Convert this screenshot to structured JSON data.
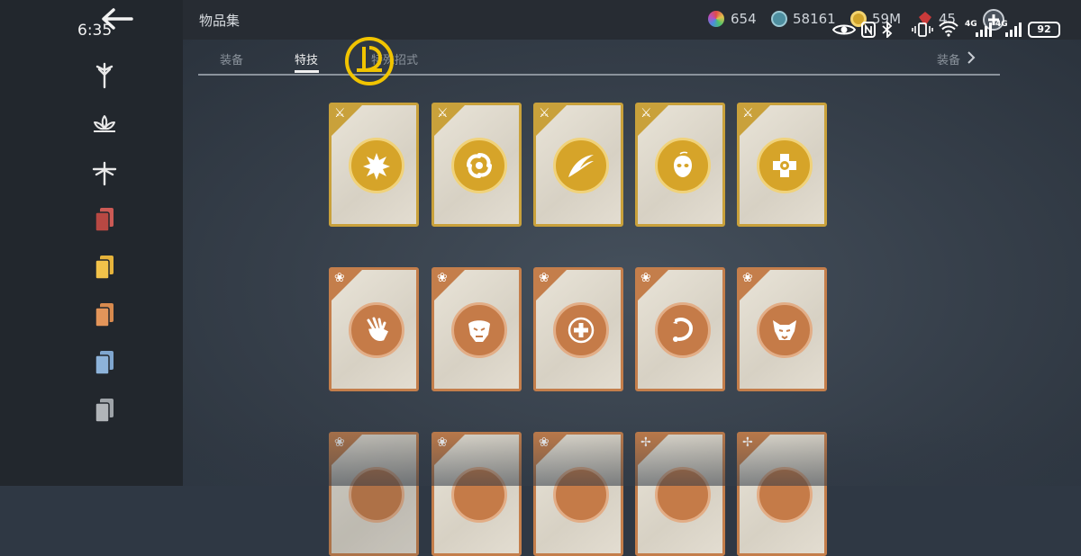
{
  "status_bar": {
    "time": "6:35",
    "battery": "92",
    "net1": "4G",
    "net2": "4G"
  },
  "header": {
    "title": "物品集"
  },
  "resources": [
    {
      "name": "color-orb",
      "value": "654",
      "color": "#b84fc0"
    },
    {
      "name": "spiral-coin",
      "value": "58161",
      "color": "#4e8fa0"
    },
    {
      "name": "gold-coin",
      "value": "59M",
      "color": "#d1a52c"
    },
    {
      "name": "red-gem",
      "value": "45",
      "color": "#c83a3a"
    }
  ],
  "tabs": [
    {
      "label": "装备",
      "active": false
    },
    {
      "label": "特技",
      "active": true
    },
    {
      "label": "特殊招式",
      "active": false
    }
  ],
  "tab_right": {
    "label": "装备"
  },
  "sidebar": {
    "items": [
      {
        "icon": "sword-emblem-icon"
      },
      {
        "icon": "lotus-emblem-icon"
      },
      {
        "icon": "dragonfly-emblem-icon"
      },
      {
        "icon": "red-cards-icon",
        "color": "#cc5a55"
      },
      {
        "icon": "yellow-cards-icon",
        "color": "#e6b33b"
      },
      {
        "icon": "orange-cards-icon",
        "color": "#d88a4e"
      },
      {
        "icon": "blue-cards-icon",
        "color": "#7fa6cf"
      },
      {
        "icon": "grey-cards-icon",
        "color": "#9ea3a8"
      }
    ]
  },
  "cards": {
    "row1": [
      {
        "rarity": "gold",
        "icon": "burst-icon"
      },
      {
        "rarity": "gold",
        "icon": "vortex-icon"
      },
      {
        "rarity": "gold",
        "icon": "wing-slash-icon"
      },
      {
        "rarity": "gold",
        "icon": "mask-icon"
      },
      {
        "rarity": "gold",
        "icon": "cross-shield-icon"
      }
    ],
    "row2": [
      {
        "rarity": "bronze",
        "icon": "claw-hand-icon"
      },
      {
        "rarity": "bronze",
        "icon": "beast-head-icon"
      },
      {
        "rarity": "bronze",
        "icon": "heal-plus-icon"
      },
      {
        "rarity": "bronze",
        "icon": "scorpion-icon"
      },
      {
        "rarity": "bronze",
        "icon": "wolf-head-icon"
      }
    ],
    "row3": [
      {
        "rarity": "bronze",
        "icon": "lotus-emblem-icon"
      },
      {
        "rarity": "bronze",
        "icon": "lotus-emblem-icon"
      },
      {
        "rarity": "bronze",
        "icon": "lotus-emblem-icon"
      },
      {
        "rarity": "bronze",
        "icon": "dragonfly-emblem-icon"
      },
      {
        "rarity": "bronze",
        "icon": "dragonfly-emblem-icon"
      }
    ]
  }
}
